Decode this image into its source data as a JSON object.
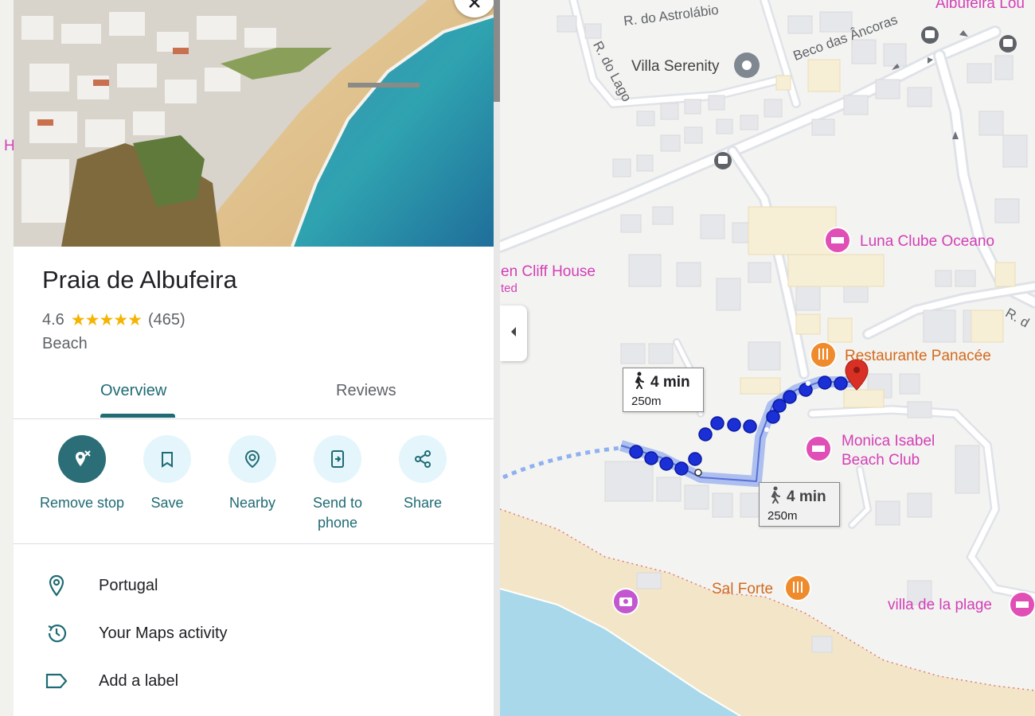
{
  "place": {
    "title": "Praia de Albufeira",
    "rating": "4.6",
    "stars": "★★★★★",
    "review_count": "(465)",
    "category": "Beach"
  },
  "tabs": [
    {
      "label": "Overview",
      "active": true
    },
    {
      "label": "Reviews",
      "active": false
    }
  ],
  "actions": [
    {
      "label": "Remove stop",
      "icon": "remove-stop-icon"
    },
    {
      "label": "Save",
      "icon": "bookmark-icon"
    },
    {
      "label": "Nearby",
      "icon": "nearby-icon"
    },
    {
      "label": "Send to phone",
      "icon": "send-to-phone-icon"
    },
    {
      "label": "Share",
      "icon": "share-icon"
    }
  ],
  "info": [
    {
      "text": "Portugal",
      "icon": "location-pin-icon"
    },
    {
      "text": "Your Maps activity",
      "icon": "history-icon"
    },
    {
      "text": "Add a label",
      "icon": "label-icon"
    }
  ],
  "map": {
    "roads": [
      "R. do Astrolábio",
      "R. do Lago",
      "Beco das Âncoras",
      "R. d"
    ],
    "places": {
      "top_right_partial": "Albufeira Lou",
      "villa_serenity": "Villa Serenity",
      "luna": "Luna Clube Oceano",
      "cliff_house": "en Cliff House",
      "cliff_house_sub": "ted",
      "panacee": "Restaurante Panacée",
      "monica_line1": "Monica Isabel",
      "monica_line2": "Beach Club",
      "sal_forte": "Sal Forte",
      "villa_plage": "villa de la plage",
      "left_partial": "H"
    },
    "routes": [
      {
        "time": "4 min",
        "distance": "250m"
      },
      {
        "time": "4 min",
        "distance": "250m"
      }
    ]
  },
  "colors": {
    "accent": "#1f6b74",
    "primary_button": "#2b6e78",
    "action_bg": "#e4f6fb",
    "star": "#f5b400",
    "poi_pink": "#d33fb6",
    "poi_orange": "#d36a1c",
    "route_blue": "#1a2fd6",
    "water": "#a9d8ea",
    "sand": "#f3e6c8"
  }
}
